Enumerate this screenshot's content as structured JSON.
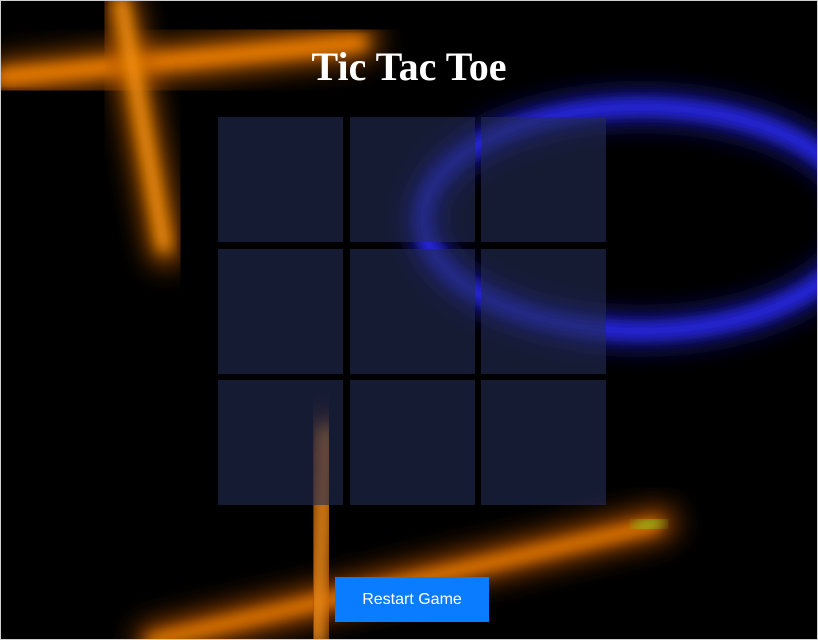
{
  "game": {
    "title": "Tic Tac Toe",
    "restart_label": "Restart Game",
    "cells": [
      "",
      "",
      "",
      "",
      "",
      "",
      "",
      "",
      ""
    ]
  },
  "colors": {
    "background": "#000000",
    "cell": "#242c54",
    "button": "#0a7cff",
    "orange_glow": "#ff8a00",
    "blue_glow": "#2a2cff"
  }
}
